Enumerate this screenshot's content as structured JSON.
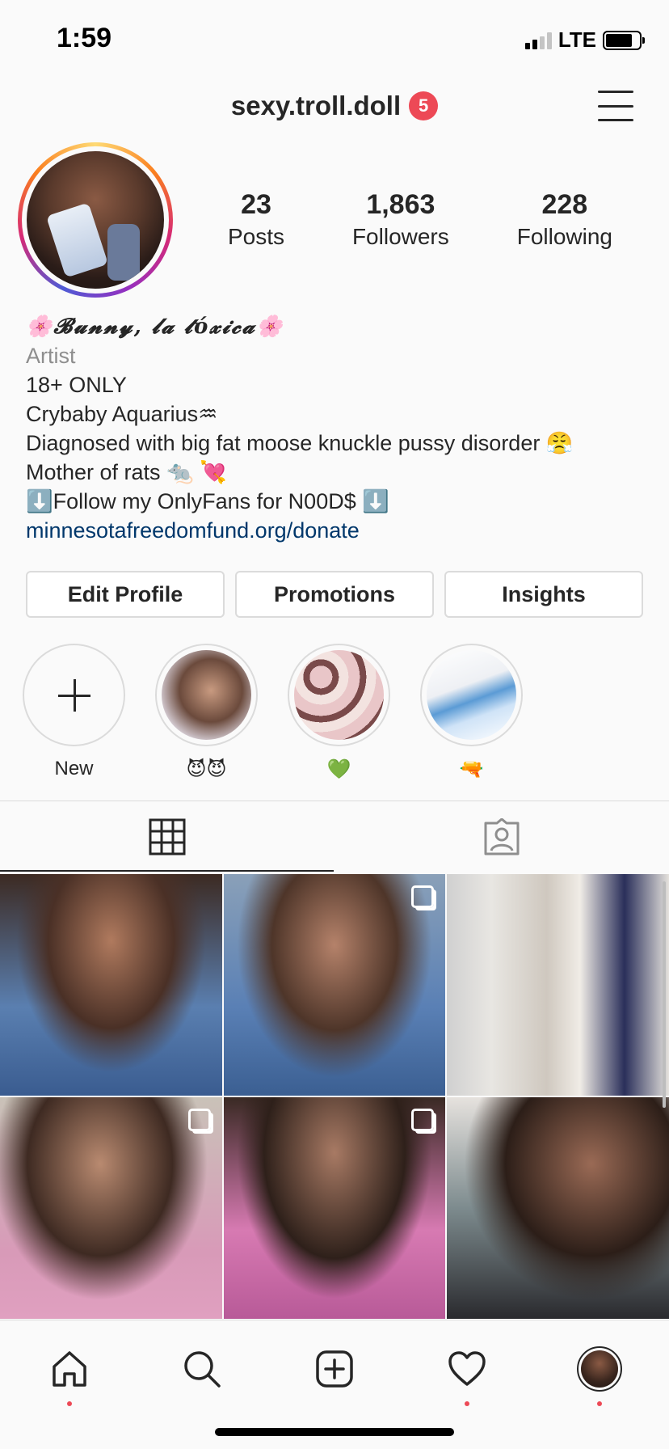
{
  "status_bar": {
    "time": "1:59",
    "network": "LTE"
  },
  "header": {
    "username": "sexy.troll.doll",
    "notification_count": "5"
  },
  "stats": {
    "posts_count": "23",
    "posts_label": "Posts",
    "followers_count": "1,863",
    "followers_label": "Followers",
    "following_count": "228",
    "following_label": "Following"
  },
  "bio": {
    "name": "🌸𝓑𝓾𝓷𝓷𝔂, 𝓵𝓪 𝓽ó𝔁𝓲𝓬𝓪🌸",
    "category": "Artist",
    "lines": [
      "18+ ONLY",
      "Crybaby Aquarius♒",
      "Diagnosed with big fat moose knuckle pussy disorder 😤",
      "Mother of rats 🐀 💘",
      "⬇️Follow my OnlyFans for N00D$ ⬇️"
    ],
    "link": "minnesotafreedomfund.org/donate"
  },
  "actions": {
    "edit_profile": "Edit Profile",
    "promotions": "Promotions",
    "insights": "Insights"
  },
  "highlights": [
    {
      "label": "New"
    },
    {
      "label": "😈😈"
    },
    {
      "label": "💚"
    },
    {
      "label": "🔫"
    }
  ],
  "colors": {
    "badge": "#ed4956",
    "link": "#00376b",
    "border": "#dbdbdb",
    "text": "#262626",
    "secondary": "#8e8e8e"
  },
  "icons": {
    "grid_tab": "grid-icon",
    "tagged_tab": "tagged-icon",
    "nav": [
      "home-icon",
      "search-icon",
      "add-post-icon",
      "heart-icon",
      "profile-avatar"
    ]
  }
}
